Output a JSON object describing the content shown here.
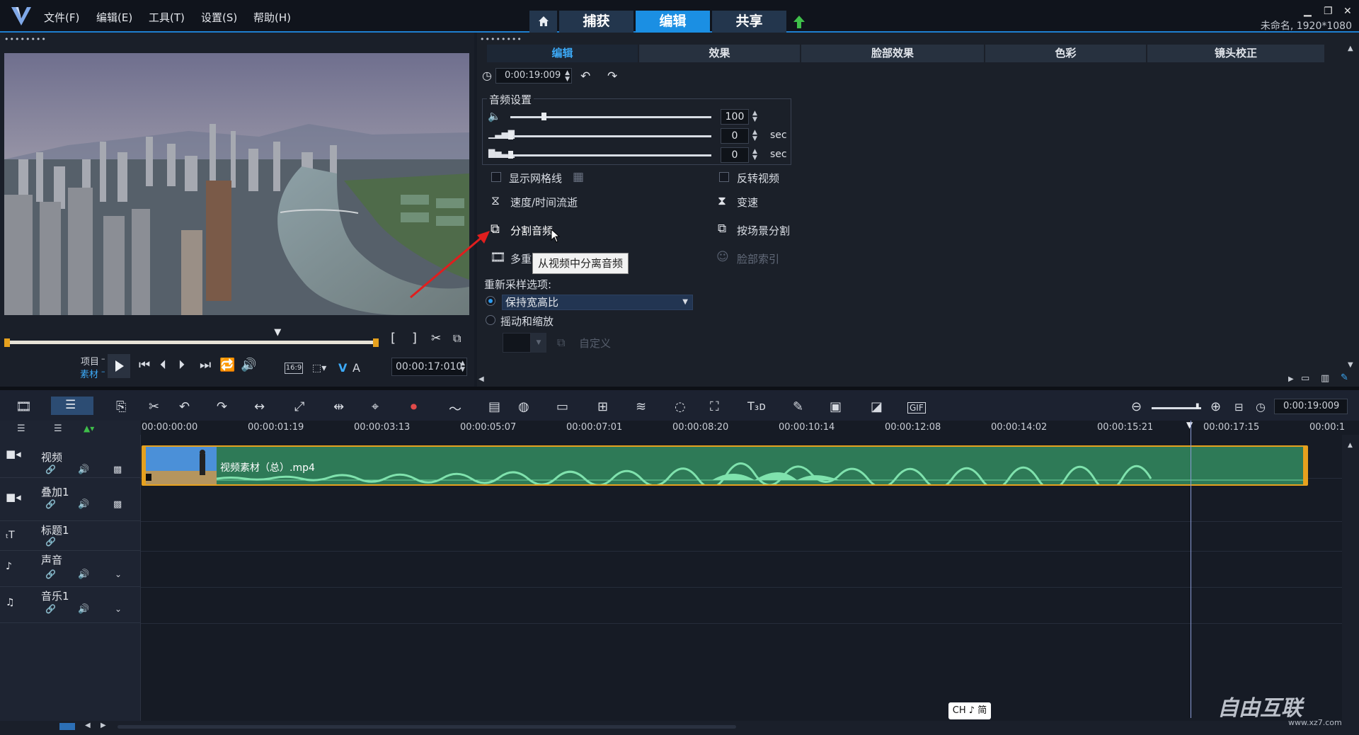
{
  "menu": [
    "文件(F)",
    "编辑(E)",
    "工具(T)",
    "设置(S)",
    "帮助(H)"
  ],
  "mode_tabs": [
    "捕获",
    "编辑",
    "共享"
  ],
  "project_info": "未命名, 1920*1080",
  "preview": {
    "mode_project": "项目",
    "mode_clip": "素材",
    "timecode": "00:00:17:010",
    "aspect": "16:9",
    "scrub_position": 0.73
  },
  "option_tabs": [
    "编辑",
    "效果",
    "脸部效果",
    "色彩",
    "镜头校正"
  ],
  "options": {
    "duration": "0:00:19:009",
    "audio_settings_label": "音频设置",
    "volume": "100",
    "fade_in": "0",
    "fade_out": "0",
    "sec_unit": "sec",
    "show_grid": "显示网格线",
    "reverse_video": "反转视频",
    "speed_time": "速度/时间流逝",
    "variable_speed": "变速",
    "split_audio": "分割音频",
    "split_by_scene": "按场景分割",
    "multi_trim": "多重",
    "face_index": "脸部索引",
    "tooltip": "从视频中分离音频",
    "resample_label": "重新采样选项:",
    "keep_aspect": "保持宽高比",
    "pan_zoom": "摇动和缩放",
    "custom": "自定义"
  },
  "timeline": {
    "zoom_timecode": "0:00:19:009",
    "ruler": [
      "00:00:00:00",
      "00:00:01:19",
      "00:00:03:13",
      "00:00:05:07",
      "00:00:07:01",
      "00:00:08:20",
      "00:00:10:14",
      "00:00:12:08",
      "00:00:14:02",
      "00:00:15:21",
      "00:00:17:15",
      "00:00:1"
    ],
    "tracks": [
      "视频",
      "叠加1",
      "标题1",
      "声音",
      "音乐1"
    ],
    "clip_name": "视频素材（总）.mp4"
  },
  "ime": "CH ♪ 简",
  "watermark": "自由互联",
  "watermark_url": "www.xz7.com",
  "colors": {
    "accent": "#1b8fe3",
    "clip": "#2e7a57",
    "clip_border": "#e6a11e"
  }
}
